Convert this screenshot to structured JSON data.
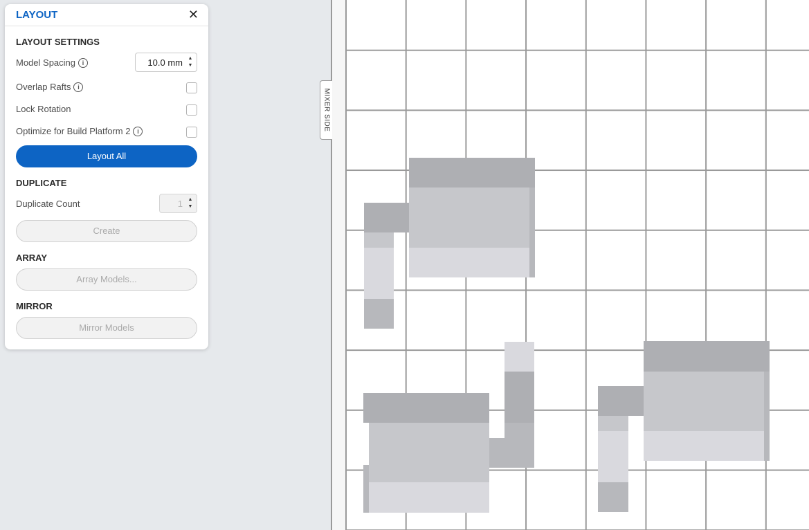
{
  "panel": {
    "title": "LAYOUT",
    "close_icon": "close-icon",
    "layout_settings": {
      "title": "LAYOUT SETTINGS",
      "model_spacing_label": "Model Spacing",
      "model_spacing_value": "10.0 mm",
      "overlap_rafts_label": "Overlap Rafts",
      "overlap_rafts_checked": false,
      "lock_rotation_label": "Lock Rotation",
      "lock_rotation_checked": false,
      "optimize_label": "Optimize for Build Platform 2",
      "optimize_checked": false,
      "layout_all_label": "Layout All"
    },
    "duplicate": {
      "title": "DUPLICATE",
      "count_label": "Duplicate Count",
      "count_value": "1",
      "create_label": "Create"
    },
    "array": {
      "title": "ARRAY",
      "button_label": "Array Models..."
    },
    "mirror": {
      "title": "MIRROR",
      "button_label": "Mirror Models"
    }
  },
  "viewport": {
    "side_tab_label": "MIXER SIDE"
  },
  "colors": {
    "accent": "#0d64c4",
    "grid_line": "#9a9a9a",
    "model_gray": "#c6c7cb"
  }
}
